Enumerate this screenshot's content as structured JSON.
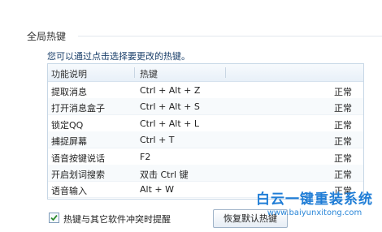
{
  "section": {
    "title": "全局热键",
    "instruction": "您可以通过点击选择要更改的热键。"
  },
  "table": {
    "headers": [
      "功能说明",
      "热键"
    ],
    "rows": [
      {
        "name": "提取消息",
        "key": "Ctrl + Alt + Z",
        "state": "正常"
      },
      {
        "name": "打开消息盒子",
        "key": "Ctrl + Alt + S",
        "state": "正常"
      },
      {
        "name": "锁定QQ",
        "key": "Ctrl + Alt + L",
        "state": "正常"
      },
      {
        "name": "捕捉屏幕",
        "key": "Ctrl + T",
        "state": "正常"
      },
      {
        "name": "语音按键说话",
        "key": "F2",
        "state": "正常"
      },
      {
        "name": "开启划词搜索",
        "key": "双击 Ctrl 键",
        "state": "正常"
      },
      {
        "name": "语音输入",
        "key": "Alt + W",
        "state": "正常"
      }
    ]
  },
  "conflict_option": {
    "label": "热键与其它软件冲突时提醒",
    "checked": true
  },
  "restore_button": {
    "label": "恢复默认热键"
  },
  "watermark": {
    "main": "白云一键重装系统",
    "url": "www.baiyunxitong.com"
  },
  "colors": {
    "check": "#2e8b2e",
    "watermark": "#1f7dd6",
    "table_border": "#c7d7e6"
  }
}
